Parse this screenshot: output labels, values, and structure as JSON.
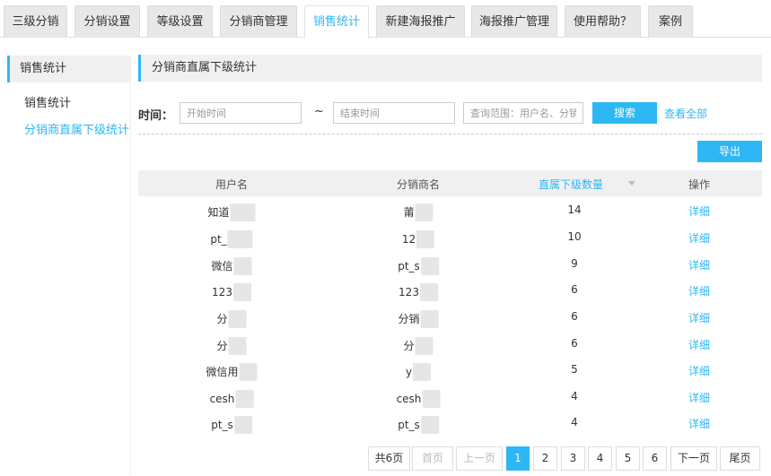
{
  "tabs": [
    {
      "label": "三级分销"
    },
    {
      "label": "分销设置"
    },
    {
      "label": "等级设置"
    },
    {
      "label": "分销商管理"
    },
    {
      "label": "销售统计"
    },
    {
      "label": "新建海报推广"
    },
    {
      "label": "海报推广管理"
    },
    {
      "label": "使用帮助？"
    },
    {
      "label": "案例"
    }
  ],
  "active_tab": "销售统计",
  "sidebar": {
    "title": "销售统计",
    "items": [
      {
        "label": "销售统计"
      },
      {
        "label": "分销商直属下级统计"
      }
    ],
    "active_item": "分销商直属下级统计"
  },
  "section_title": "分销商直属下级统计",
  "filter": {
    "time_label": "时间：",
    "start_placeholder": "开始时间",
    "separator": "~",
    "end_placeholder": "结束时间",
    "query_placeholder": "查询范围：用户名、分销商",
    "search_label": "搜索",
    "view_all_label": "查看全部"
  },
  "export_label": "导出",
  "table": {
    "headers": {
      "username": "用户名",
      "distributor": "分销商名",
      "count": "直属下级数量",
      "action": "操作"
    },
    "rows": [
      {
        "username": "知道",
        "distributor": "莆",
        "count": "14",
        "action": "详细"
      },
      {
        "username": "pt_",
        "distributor": "12",
        "count": "10",
        "action": "详细"
      },
      {
        "username": "微信",
        "distributor": "pt_s",
        "count": "9",
        "action": "详细"
      },
      {
        "username": "123",
        "distributor": "123",
        "count": "6",
        "action": "详细"
      },
      {
        "username": "分",
        "distributor": "分销",
        "count": "6",
        "action": "详细"
      },
      {
        "username": "分",
        "distributor": "分",
        "count": "6",
        "action": "详细"
      },
      {
        "username": "微信用",
        "distributor": "y",
        "count": "5",
        "action": "详细"
      },
      {
        "username": "cesh",
        "distributor": "cesh",
        "count": "4",
        "action": "详细"
      },
      {
        "username": "pt_s",
        "distributor": "pt_s",
        "count": "4",
        "action": "详细"
      }
    ]
  },
  "pagination": {
    "total": "共6页",
    "first": "首页",
    "prev": "上一页",
    "pages": [
      "1",
      "2",
      "3",
      "4",
      "5",
      "6"
    ],
    "current": "1",
    "next": "下一页",
    "last": "尾页"
  },
  "colors": {
    "accent": "#2db7f5",
    "header_bg": "#f0f0f0"
  }
}
